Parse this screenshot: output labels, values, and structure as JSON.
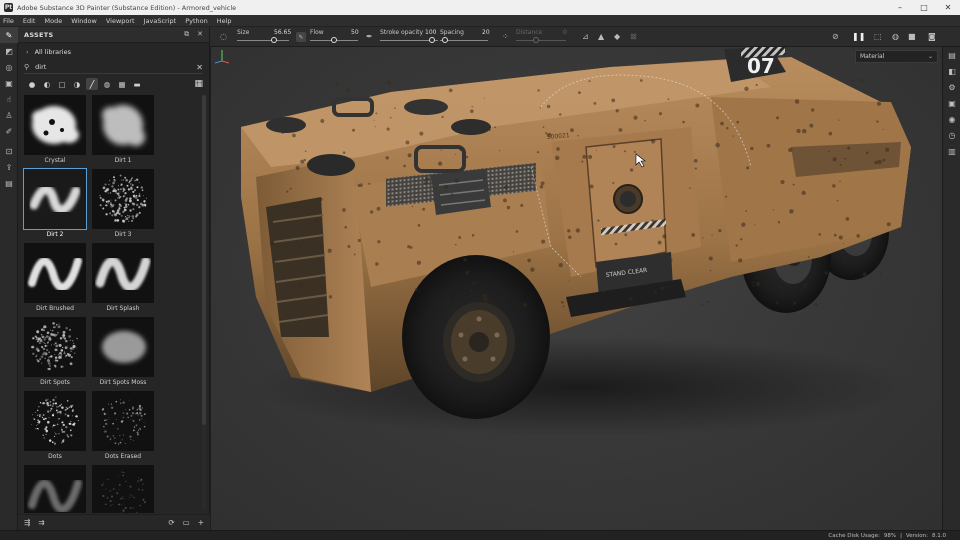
{
  "window": {
    "title": "Adobe Substance 3D Painter (Substance Edition) - Armored_vehicle",
    "logo_text": "Pt",
    "controls": [
      "–",
      "□",
      "✕"
    ]
  },
  "menu": [
    "File",
    "Edit",
    "Mode",
    "Window",
    "Viewport",
    "JavaScript",
    "Python",
    "Help"
  ],
  "left_tools": [
    "paint-brush-icon",
    "eraser-icon",
    "projection-icon",
    "polygon-fill-icon",
    "smudge-icon",
    "clone-icon",
    "color-picker-icon",
    "bake-icon",
    "export-icon",
    "save-icon"
  ],
  "assets": {
    "title": "ASSETS",
    "libraries_label": "All libraries",
    "search_value": "dirt",
    "items": [
      {
        "label": "Crystal"
      },
      {
        "label": "Dirt 1"
      },
      {
        "label": "Dirt 2",
        "selected": true
      },
      {
        "label": "Dirt 3"
      },
      {
        "label": "Dirt Brushed"
      },
      {
        "label": "Dirt Splash"
      },
      {
        "label": "Dirt Spots"
      },
      {
        "label": "Dirt Spots Moss"
      },
      {
        "label": "Dots"
      },
      {
        "label": "Dots Erased"
      },
      {
        "label": ""
      },
      {
        "label": ""
      }
    ]
  },
  "toolbar": {
    "size_label": "Size",
    "size_value": "56.65",
    "flow_label": "Flow",
    "flow_value": "50",
    "stroke_opacity_label": "Stroke opacity",
    "stroke_opacity_value": "100",
    "spacing_label": "Spacing",
    "spacing_value": "20",
    "distance_label": "Distance",
    "distance_value": "0",
    "material_dropdown": "Material"
  },
  "viewport": {
    "vehicle_number": "07",
    "stencil_text": "STAND CLEAR",
    "serial_text": "S00021"
  },
  "status": {
    "cache_label": "Cache Disk Usage:",
    "cache_value": "98%",
    "version_label": "Version:",
    "version_value": "8.1.0"
  }
}
